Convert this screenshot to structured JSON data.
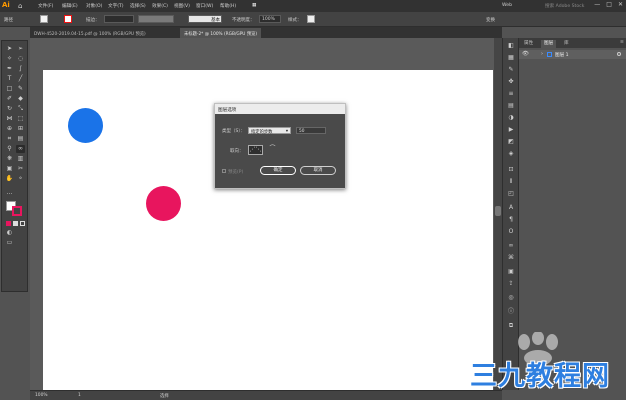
{
  "app": {
    "logo": "Ai"
  },
  "menubar": {
    "items": [
      "文件(F)",
      "编辑(E)",
      "对象(O)",
      "文字(T)",
      "选择(S)",
      "效果(C)",
      "视图(V)",
      "窗口(W)",
      "帮助(H)"
    ],
    "workspace": "Web",
    "search_placeholder": "搜索 Adobe Stock"
  },
  "controlbar": {
    "selection_label": "路径",
    "stroke_label": "描边：",
    "brush_label": "基本",
    "opacity_label": "不透明度：",
    "opacity_value": "100%",
    "style_label": "样式：",
    "transform_label": "变换"
  },
  "tabs": [
    {
      "label": "DWH-4520-2019.04-15.pdf @ 100% (RGB/GPU 预览)",
      "active": false
    },
    {
      "label": "未标题-2* @ 100% (RGB/GPU 预览)",
      "active": true
    }
  ],
  "canvas": {
    "circles": [
      {
        "name": "blue-circle",
        "color": "#1a73e8"
      },
      {
        "name": "pink-circle",
        "color": "#e8155e"
      }
    ]
  },
  "statusbar": {
    "zoom": "100%",
    "page": "1",
    "tool": "选择"
  },
  "layers_panel": {
    "tabs": [
      "属性",
      "图层",
      "库"
    ],
    "active_tab": "图层",
    "layer_name": "图层 1"
  },
  "dialog": {
    "title": "图层选项",
    "type_label": "类型（S）：",
    "type_value": "指定的步数",
    "steps_value": "50",
    "orientation_label": "取向：",
    "preview_label": "预览(P)",
    "ok_label": "确定",
    "cancel_label": "取消"
  },
  "watermark": {
    "text": "三九教程网"
  }
}
